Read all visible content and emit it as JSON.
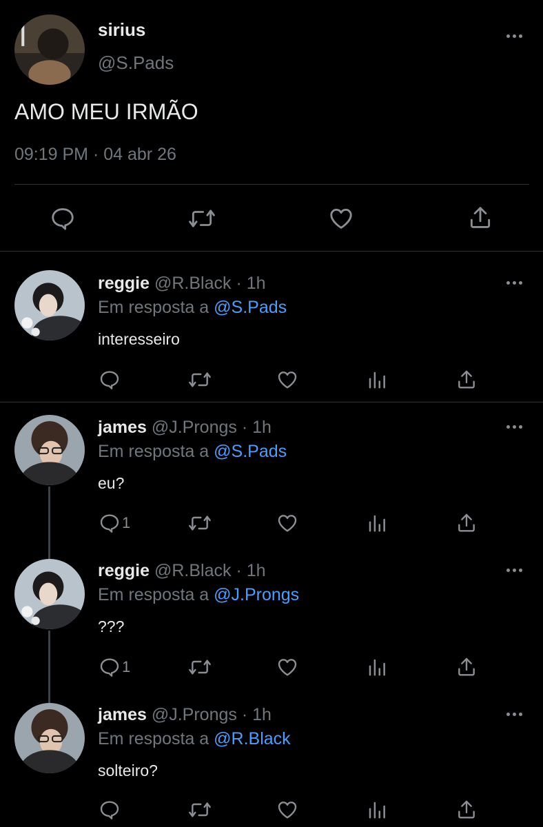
{
  "main_tweet": {
    "name": "sirius",
    "handle": "@S.Pads",
    "text": "AMO MEU IRMÃO",
    "time": "09:19 PM",
    "sep": "·",
    "date": "04 abr 26"
  },
  "replies": [
    {
      "name": "reggie",
      "handle": "@R.Black",
      "sep": "·",
      "age": "1h",
      "reply_prefix": "Em resposta a",
      "reply_to": "@S.Pads",
      "text": "interesseiro",
      "reply_count": ""
    },
    {
      "name": "james",
      "handle": "@J.Prongs",
      "sep": "·",
      "age": "1h",
      "reply_prefix": "Em resposta a",
      "reply_to": "@S.Pads",
      "text": "eu?",
      "reply_count": "1"
    },
    {
      "name": "reggie",
      "handle": "@R.Black",
      "sep": "·",
      "age": "1h",
      "reply_prefix": "Em resposta a",
      "reply_to": "@J.Prongs",
      "text": "???",
      "reply_count": "1"
    },
    {
      "name": "james",
      "handle": "@J.Prongs",
      "sep": "·",
      "age": "1h",
      "reply_prefix": "Em resposta a",
      "reply_to": "@R.Black",
      "text": "solteiro?",
      "reply_count": ""
    }
  ],
  "colors": {
    "background": "#000000",
    "text": "#e7e9ea",
    "muted": "#71767b",
    "link": "#4a9eff",
    "divider": "#2f3336"
  },
  "icons": [
    "reply-icon",
    "retweet-icon",
    "like-icon",
    "share-icon",
    "views-icon",
    "more-icon"
  ]
}
